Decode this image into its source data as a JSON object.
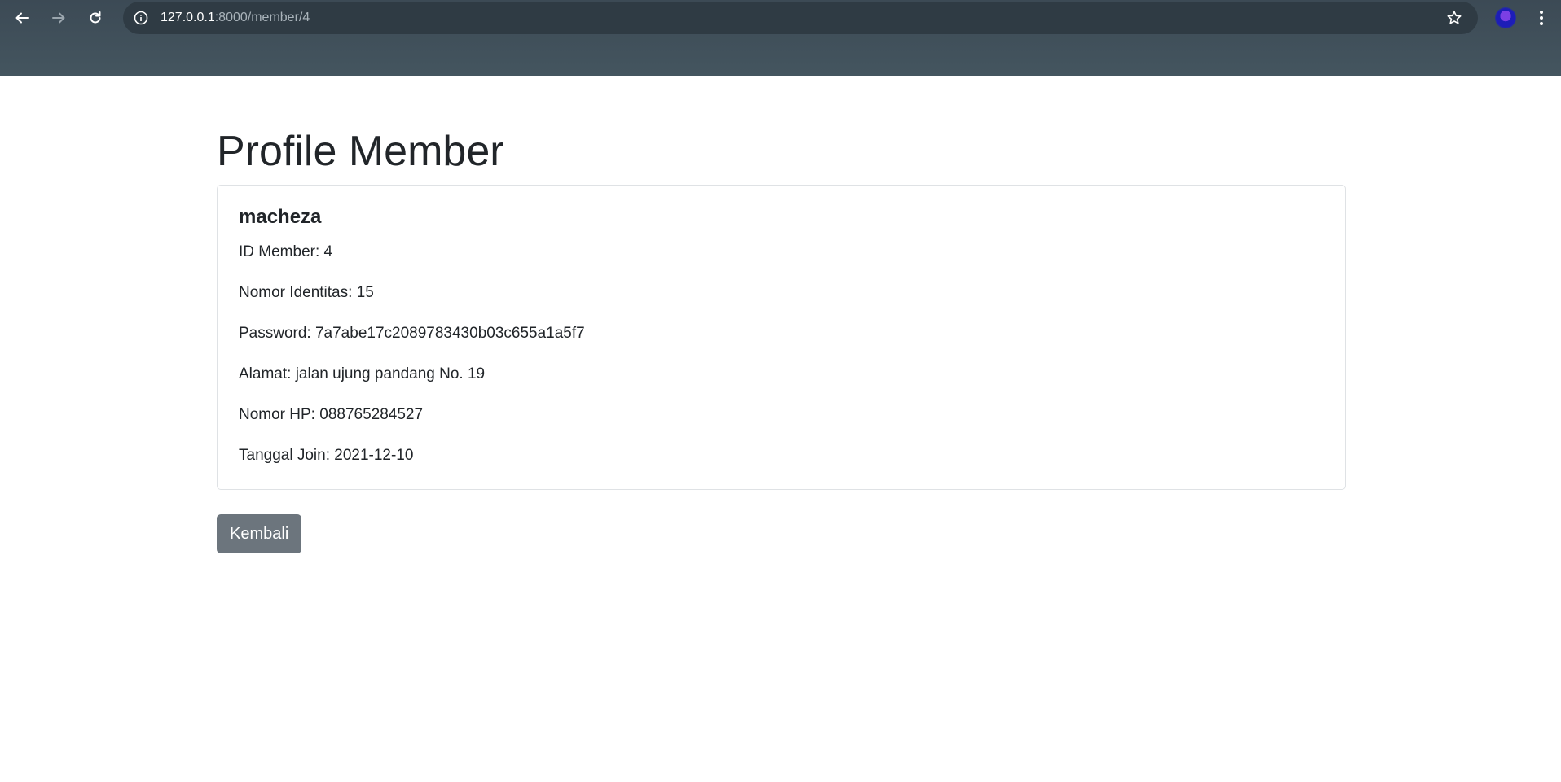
{
  "browser": {
    "url_host": "127.0.0.1",
    "url_path": ":8000/member/4"
  },
  "page": {
    "title": "Profile Member"
  },
  "member": {
    "name": "macheza",
    "fields": [
      {
        "label": "ID Member: ",
        "value": "4"
      },
      {
        "label": "Nomor Identitas: ",
        "value": "15"
      },
      {
        "label": "Password: ",
        "value": "7a7abe17c2089783430b03c655a1a5f7"
      },
      {
        "label": "Alamat: ",
        "value": "jalan ujung pandang No. 19"
      },
      {
        "label": "Nomor HP: ",
        "value": "088765284527"
      },
      {
        "label": "Tanggal Join: ",
        "value": "2021-12-10"
      }
    ]
  },
  "actions": {
    "back_label": "Kembali"
  },
  "colors": {
    "chrome_bg": "#44555f",
    "button_secondary": "#6c757d",
    "text": "#212529"
  },
  "icons": [
    "back-arrow-icon",
    "forward-arrow-icon",
    "reload-icon",
    "info-icon",
    "star-icon",
    "kebab-menu-icon"
  ]
}
